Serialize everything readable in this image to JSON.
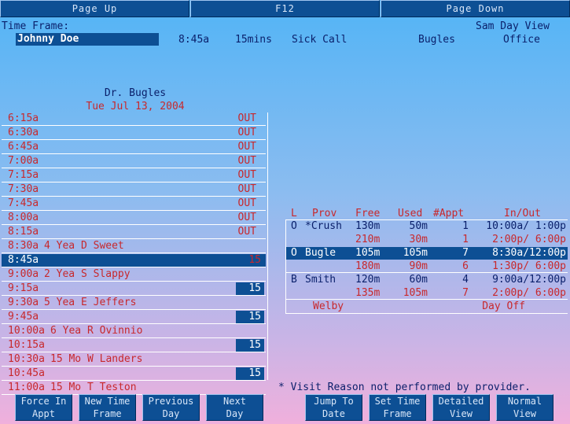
{
  "topbar": {
    "page_up": "Page Up",
    "f12": "F12",
    "page_down": "Page Down"
  },
  "header": {
    "time_frame_label": "Time Frame:",
    "view_mode": "Sam Day View",
    "patient_name": "Johnny Doe",
    "time": "8:45a",
    "duration": "15mins",
    "reason": "Sick Call",
    "provider": "Bugles",
    "location": "Office"
  },
  "schedule": {
    "doctor": "Dr. Bugles",
    "date": "Tue Jul 13, 2004",
    "rows": [
      {
        "time": "6:15a",
        "patient": "",
        "status": "OUT",
        "minutes": ""
      },
      {
        "time": "6:30a",
        "patient": "",
        "status": "OUT",
        "minutes": ""
      },
      {
        "time": "6:45a",
        "patient": "",
        "status": "OUT",
        "minutes": ""
      },
      {
        "time": "7:00a",
        "patient": "",
        "status": "OUT",
        "minutes": ""
      },
      {
        "time": "7:15a",
        "patient": "",
        "status": "OUT",
        "minutes": ""
      },
      {
        "time": "7:30a",
        "patient": "",
        "status": "OUT",
        "minutes": ""
      },
      {
        "time": "7:45a",
        "patient": "",
        "status": "OUT",
        "minutes": ""
      },
      {
        "time": "8:00a",
        "patient": "",
        "status": "OUT",
        "minutes": ""
      },
      {
        "time": "8:15a",
        "patient": "",
        "status": "OUT",
        "minutes": ""
      },
      {
        "time": "8:30a",
        "patient": "4 Yea D Sweet",
        "status": "",
        "minutes": ""
      },
      {
        "time": "8:45a",
        "patient": "",
        "status": "",
        "minutes": "15"
      },
      {
        "time": "9:00a",
        "patient": "2 Yea S Slappy",
        "status": "",
        "minutes": ""
      },
      {
        "time": "9:15a",
        "patient": "",
        "status": "",
        "minutes": "15"
      },
      {
        "time": "9:30a",
        "patient": "5 Yea E Jeffers",
        "status": "",
        "minutes": ""
      },
      {
        "time": "9:45a",
        "patient": "",
        "status": "",
        "minutes": "15"
      },
      {
        "time": "10:00a",
        "patient": "6 Yea R Ovinnio",
        "status": "",
        "minutes": ""
      },
      {
        "time": "10:15a",
        "patient": "",
        "status": "",
        "minutes": "15"
      },
      {
        "time": "10:30a",
        "patient": "15 Mo W Landers",
        "status": "",
        "minutes": ""
      },
      {
        "time": "10:45a",
        "patient": "",
        "status": "",
        "minutes": "15"
      },
      {
        "time": "11:00a",
        "patient": "15 Mo T Teston",
        "status": "",
        "minutes": ""
      }
    ]
  },
  "providers": {
    "headers": {
      "l": "L",
      "prov": "Prov",
      "free": "Free",
      "used": "Used",
      "appt": "#Appt",
      "inout": "In/Out"
    },
    "rows": [
      {
        "l": "O",
        "prov": "*Crush",
        "free": "130m",
        "used": "50m",
        "appt": "1",
        "inout": "10:00a/ 1:00p"
      },
      {
        "l": "",
        "prov": "",
        "free": "210m",
        "used": "30m",
        "appt": "1",
        "inout": "2:00p/ 6:00p"
      },
      {
        "l": "O",
        "prov": "Bugle",
        "free": "105m",
        "used": "105m",
        "appt": "7",
        "inout": "8:30a/12:00p"
      },
      {
        "l": "",
        "prov": "",
        "free": "180m",
        "used": "90m",
        "appt": "6",
        "inout": "1:30p/ 6:00p"
      },
      {
        "l": "B",
        "prov": "Smith",
        "free": "120m",
        "used": "60m",
        "appt": "4",
        "inout": "9:00a/12:00p"
      },
      {
        "l": "",
        "prov": "",
        "free": "135m",
        "used": "105m",
        "appt": "7",
        "inout": "2:00p/ 6:00p"
      },
      {
        "l": "",
        "prov": "Welby",
        "free": "",
        "used": "",
        "appt": "",
        "inout": "Day Off"
      }
    ]
  },
  "footnote": "* Visit Reason not performed by provider.",
  "buttons": {
    "force_in": [
      "Force In",
      "Appt"
    ],
    "new_time": [
      "New Time",
      "Frame"
    ],
    "prev_day": [
      "Previous",
      "Day"
    ],
    "next_day": [
      "Next",
      "Day"
    ],
    "jump_to": [
      "Jump To",
      "Date"
    ],
    "set_time": [
      "Set Time",
      "Frame"
    ],
    "detailed": [
      "Detailed",
      "View"
    ],
    "normal": [
      "Normal",
      "View"
    ]
  }
}
